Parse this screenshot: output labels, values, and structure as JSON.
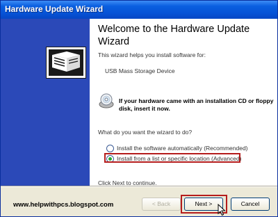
{
  "window": {
    "title": "Hardware Update Wizard"
  },
  "main": {
    "heading": "Welcome to the Hardware Update Wizard",
    "intro": "This wizard helps you install software for:",
    "device": "USB Mass Storage Device",
    "cd_note": "If your hardware came with an installation CD or floppy disk, insert it now.",
    "question": "What do you want the wizard to do?",
    "options": [
      {
        "label": "Install the software automatically (Recommended)",
        "selected": false
      },
      {
        "label": "Install from a list or specific location (Advanced)",
        "selected": true
      }
    ],
    "continue": "Click Next to continue."
  },
  "footer": {
    "website": "www.helpwithpcs.blogspot.com",
    "back_label": "< Back",
    "next_label": "Next >",
    "cancel_label": "Cancel"
  },
  "icons": {
    "wizard": "hardware-wizard-icon",
    "cd": "cd-disk-icon",
    "cursor": "mouse-pointer-icon"
  },
  "colors": {
    "titlebar": "#0652d6",
    "side_panel": "#2b49b8",
    "highlight": "#b51c1c",
    "radio_selected": "#26a833"
  }
}
